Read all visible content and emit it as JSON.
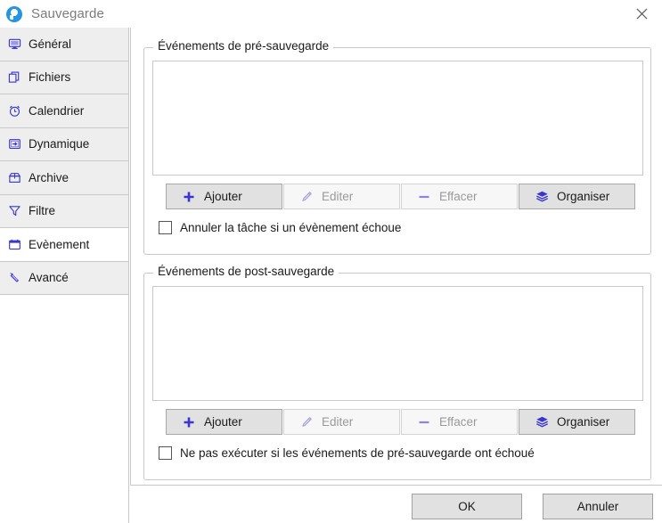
{
  "window": {
    "title": "Sauvegarde",
    "icon": "backup-disc-icon",
    "close_icon": "close-icon"
  },
  "sidebar": {
    "items": [
      {
        "label": "Général",
        "icon": "monitor-icon",
        "selected": false
      },
      {
        "label": "Fichiers",
        "icon": "files-icon",
        "selected": false
      },
      {
        "label": "Calendrier",
        "icon": "alarm-clock-icon",
        "selected": false
      },
      {
        "label": "Dynamique",
        "icon": "arrow-box-icon",
        "selected": false
      },
      {
        "label": "Archive",
        "icon": "archive-box-icon",
        "selected": false
      },
      {
        "label": "Filtre",
        "icon": "funnel-icon",
        "selected": false
      },
      {
        "label": "Evènement",
        "icon": "calendar-icon",
        "selected": true
      },
      {
        "label": "Avancé",
        "icon": "wrench-icon",
        "selected": false
      }
    ]
  },
  "main": {
    "groups": [
      {
        "title": "Événements de pré-sauvegarde",
        "list_items": [],
        "buttons": [
          {
            "label": "Ajouter",
            "icon": "plus-icon",
            "enabled": true
          },
          {
            "label": "Editer",
            "icon": "pencil-icon",
            "enabled": false
          },
          {
            "label": "Effacer",
            "icon": "minus-icon",
            "enabled": false
          },
          {
            "label": "Organiser",
            "icon": "layers-icon",
            "enabled": true
          }
        ],
        "checkbox": {
          "label": "Annuler la tâche si un évènement échoue",
          "checked": false
        }
      },
      {
        "title": "Événements de post-sauvegarde",
        "list_items": [],
        "buttons": [
          {
            "label": "Ajouter",
            "icon": "plus-icon",
            "enabled": true
          },
          {
            "label": "Editer",
            "icon": "pencil-icon",
            "enabled": false
          },
          {
            "label": "Effacer",
            "icon": "minus-icon",
            "enabled": false
          },
          {
            "label": "Organiser",
            "icon": "layers-icon",
            "enabled": true
          }
        ],
        "checkbox": {
          "label": "Ne pas exécuter si les événements de pré-sauvegarde ont échoué",
          "checked": false
        }
      }
    ]
  },
  "footer": {
    "ok_label": "OK",
    "cancel_label": "Annuler"
  },
  "colors": {
    "accent": "#3a34d2",
    "accent_disabled": "#a7a4e8",
    "title_icon": "#2196e3",
    "sidebar_item": "#eeeeee",
    "sidebar_selected": "#ffffff",
    "button_face": "#e1e1e1",
    "border": "#c8c8c8"
  }
}
